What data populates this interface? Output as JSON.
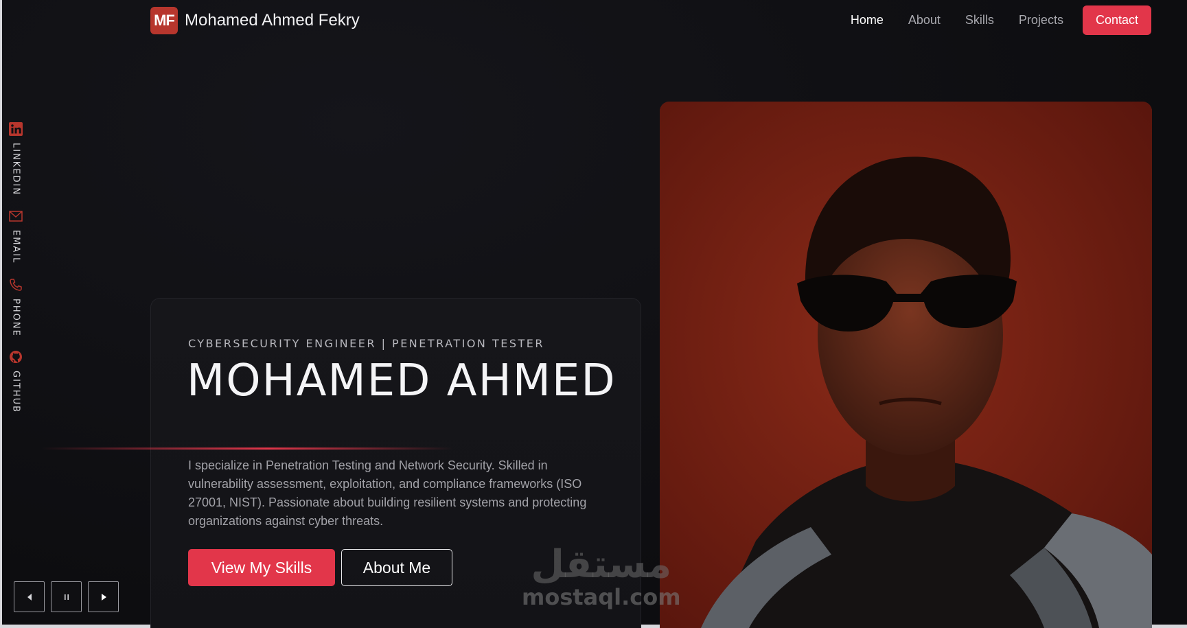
{
  "brand": {
    "badge": "MF",
    "name": "Mohamed Ahmed Fekry"
  },
  "nav": {
    "items": [
      {
        "label": "Home",
        "active": true
      },
      {
        "label": "About",
        "active": false
      },
      {
        "label": "Skills",
        "active": false
      },
      {
        "label": "Projects",
        "active": false
      }
    ],
    "contact_label": "Contact"
  },
  "social": [
    {
      "label": "LINKEDIN",
      "icon": "linkedin-icon"
    },
    {
      "label": "EMAIL",
      "icon": "email-icon"
    },
    {
      "label": "PHONE",
      "icon": "phone-icon"
    },
    {
      "label": "GITHUB",
      "icon": "github-icon"
    }
  ],
  "hero": {
    "subtitle": "CYBERSECURITY ENGINEER | PENETRATION TESTER",
    "name": "MOHAMED AHMED",
    "description": "I specialize in Penetration Testing and Network Security. Skilled in vulnerability assessment, exploitation, and compliance frameworks (ISO 27001, NIST). Passionate about building resilient systems and protecting organizations against cyber threats.",
    "primary_button": "View My Skills",
    "secondary_button": "About Me"
  },
  "carousel_controls": [
    "prev-icon",
    "pause-icon",
    "next-icon"
  ],
  "watermark": {
    "arabic": "مستقل",
    "latin": "mostaql.com"
  },
  "colors": {
    "accent": "#e2364a",
    "logo": "#b7362d",
    "background": "#0f0f12"
  }
}
